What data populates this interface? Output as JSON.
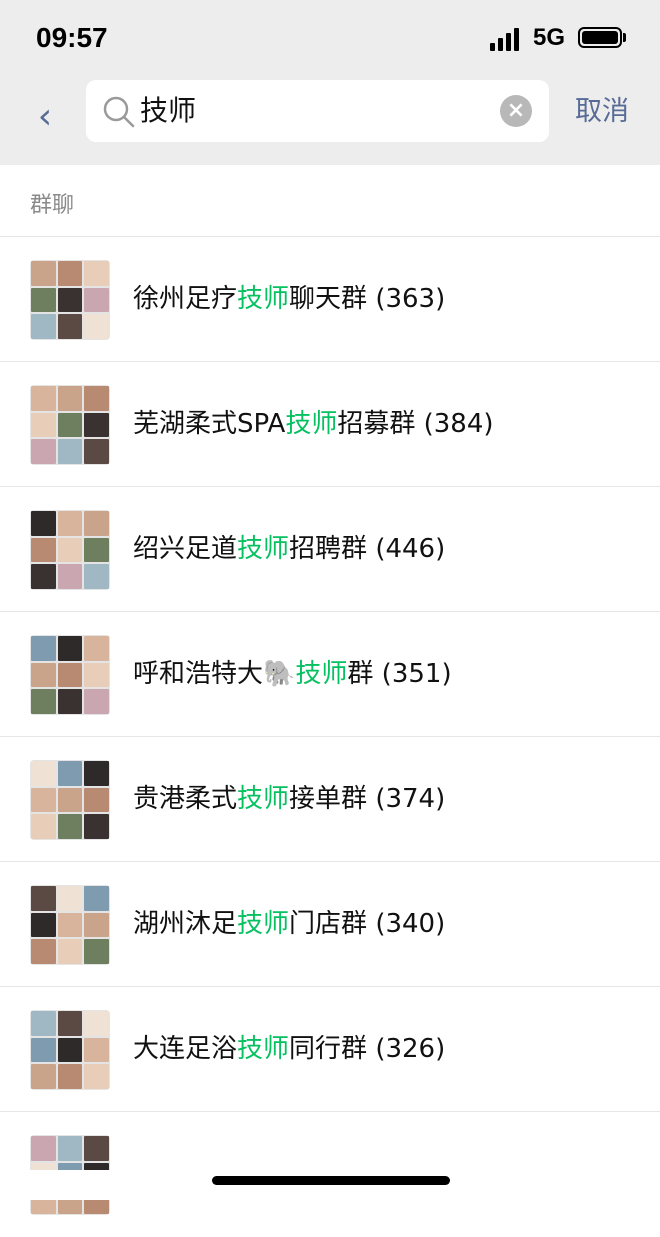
{
  "status_bar": {
    "time": "09:57",
    "network": "5G"
  },
  "search": {
    "query": "技师",
    "cancel_label": "取消"
  },
  "section_title": "群聊",
  "groups": [
    {
      "pre": "徐州足疗",
      "hl": "技师",
      "post": "聊天群",
      "count": "(363)"
    },
    {
      "pre": "芜湖柔式SPA",
      "hl": "技师",
      "post": "招募群",
      "count": "(384)"
    },
    {
      "pre": "绍兴足道",
      "hl": "技师",
      "post": "招聘群",
      "count": "(446)"
    },
    {
      "pre": "呼和浩特大🐘",
      "hl": "技师",
      "post": "群",
      "count": "(351)"
    },
    {
      "pre": "贵港柔式",
      "hl": "技师",
      "post": "接单群",
      "count": "(374)"
    },
    {
      "pre": "湖州沐足",
      "hl": "技师",
      "post": "门店群",
      "count": "(340)"
    },
    {
      "pre": "大连足浴",
      "hl": "技师",
      "post": "同行群",
      "count": "(326)"
    },
    {
      "pre": "",
      "hl": "",
      "post": "",
      "count": ""
    }
  ],
  "colors": {
    "highlight": "#07c160",
    "link": "#576b95",
    "header_bg": "#ededed"
  }
}
